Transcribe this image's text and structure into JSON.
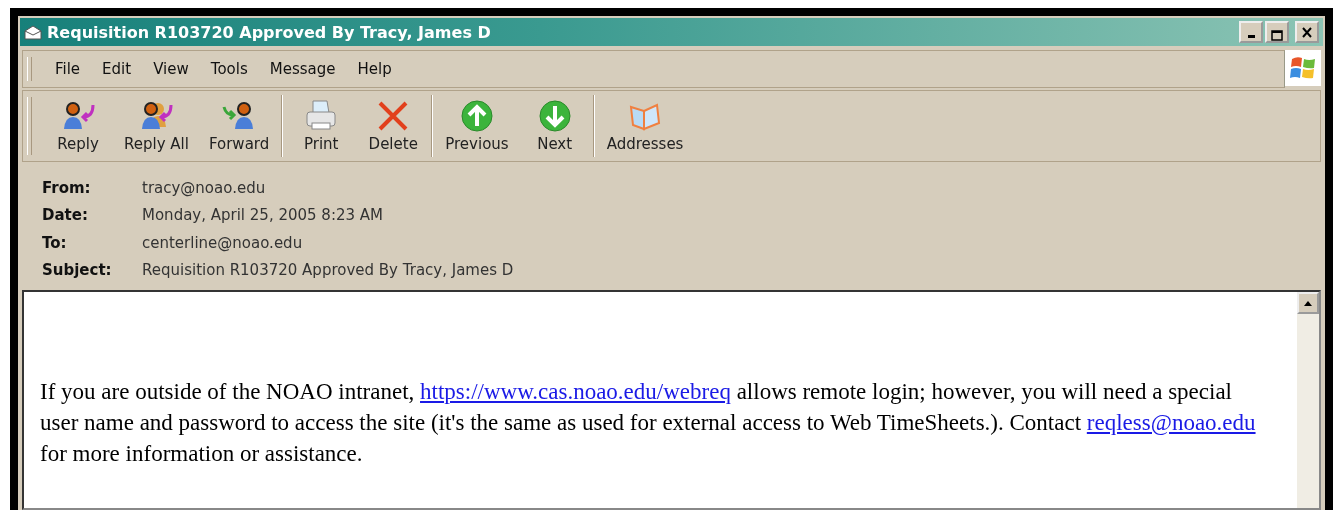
{
  "window": {
    "title": "Requisition R103720 Approved By Tracy, James D"
  },
  "menu": [
    "File",
    "Edit",
    "View",
    "Tools",
    "Message",
    "Help"
  ],
  "toolbar": [
    [
      {
        "label": "Reply",
        "kind": "reply"
      },
      {
        "label": "Reply All",
        "kind": "reply-all"
      },
      {
        "label": "Forward",
        "kind": "forward"
      }
    ],
    [
      {
        "label": "Print",
        "kind": "print"
      },
      {
        "label": "Delete",
        "kind": "delete"
      }
    ],
    [
      {
        "label": "Previous",
        "kind": "previous"
      },
      {
        "label": "Next",
        "kind": "next"
      }
    ],
    [
      {
        "label": "Addresses",
        "kind": "addresses"
      }
    ]
  ],
  "headers": [
    {
      "label": "From:",
      "value": "tracy@noao.edu"
    },
    {
      "label": "Date:",
      "value": "Monday, April 25, 2005 8:23 AM"
    },
    {
      "label": "To:",
      "value": "centerline@noao.edu"
    },
    {
      "label": "Subject:",
      "value": "Requisition R103720 Approved By Tracy, James D"
    }
  ],
  "body": [
    {
      "kind": "text",
      "text": "If you are outside of the NOAO intranet, "
    },
    {
      "kind": "link",
      "text": "https://www.cas.noao.edu/webreq"
    },
    {
      "kind": "text",
      "text": " allows remote login; however, you will need a special user name and password to access the site (it's the same as used for external access to Web TimeSheets.).  Contact "
    },
    {
      "kind": "link",
      "text": "reqless@noao.edu"
    },
    {
      "kind": "text",
      "text": " for more information or assistance."
    }
  ]
}
